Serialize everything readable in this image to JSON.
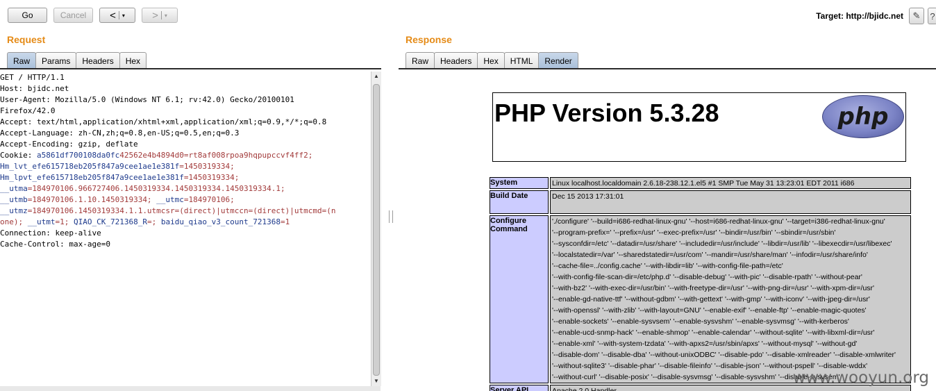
{
  "toolbar": {
    "go_label": "Go",
    "cancel_label": "Cancel",
    "back_label": "<",
    "forward_label": ">",
    "dropdown": "▾",
    "target_prefix": "Target: ",
    "target_url": "http://bjidc.net"
  },
  "request": {
    "title": "Request",
    "tabs": [
      "Raw",
      "Params",
      "Headers",
      "Hex"
    ],
    "active_tab": "Raw",
    "lines": [
      {
        "t": "GET / HTTP/1.1"
      },
      {
        "t": "Host: bjidc.net"
      },
      {
        "t": "User-Agent: Mozilla/5.0 (Windows NT 6.1; rv:42.0) Gecko/20100101"
      },
      {
        "t": "Firefox/42.0"
      },
      {
        "t": "Accept: text/html,application/xhtml+xml,application/xml;q=0.9,*/*;q=0.8"
      },
      {
        "t": "Accept-Language: zh-CN,zh;q=0.8,en-US;q=0.5,en;q=0.3"
      },
      {
        "t": "Accept-Encoding: gzip, deflate"
      },
      {
        "parts": [
          [
            "",
            "Cookie: "
          ],
          [
            "ck",
            "a5861df700108da0fc"
          ],
          [
            "cv",
            "42562e4b4894d0=rt8af008rpoa9hqpupccvf4ff2;"
          ]
        ]
      },
      {
        "parts": [
          [
            "ck",
            "Hm_lvt_efe615718eb205f847a9cee1ae1e381f"
          ],
          [
            "cv",
            "=1450319334;"
          ]
        ]
      },
      {
        "parts": [
          [
            "ck",
            "Hm_lpvt_efe615718eb205f847a9cee1ae1e381f"
          ],
          [
            "cv",
            "=1450319334;"
          ]
        ]
      },
      {
        "parts": [
          [
            "ck",
            "__utma"
          ],
          [
            "cv",
            "=184970106.966727406.1450319334.1450319334.1450319334.1;"
          ]
        ]
      },
      {
        "parts": [
          [
            "ck",
            "__utmb"
          ],
          [
            "cv",
            "=184970106.1.10.1450319334;"
          ],
          [
            "ck",
            " __utmc"
          ],
          [
            "cv",
            "=184970106;"
          ]
        ]
      },
      {
        "parts": [
          [
            "ck",
            "__utmz"
          ],
          [
            "cv",
            "=184970106.1450319334.1.1.utmcsr=(direct)|utmccn=(direct)|utmcmd=(n"
          ]
        ]
      },
      {
        "parts": [
          [
            "cv",
            "one);"
          ],
          [
            "ck",
            " __utmt"
          ],
          [
            "cv",
            "=1;"
          ],
          [
            "ck",
            " QIAO_CK_721368_R"
          ],
          [
            "cv",
            "=;"
          ],
          [
            "ck",
            " baidu_qiao_v3_count_721368"
          ],
          [
            "cv",
            "=1"
          ]
        ]
      },
      {
        "t": "Connection: keep-alive"
      },
      {
        "t": "Cache-Control: max-age=0"
      }
    ]
  },
  "response": {
    "title": "Response",
    "tabs": [
      "Raw",
      "Headers",
      "Hex",
      "HTML",
      "Render"
    ],
    "active_tab": "Render",
    "php_version": "PHP Version 5.3.28",
    "php_logo_text": "php",
    "rows": [
      {
        "key": "System",
        "lines": [
          "Linux localhost.localdomain 2.6.18-238.12.1.el5 #1 SMP Tue May 31 13:23:01 EDT 2011 i686"
        ]
      },
      {
        "key": "Build Date",
        "lines": [
          "Dec 15 2013 17:31:01"
        ]
      },
      {
        "key": "Configure Command",
        "lines": [
          "'./configure' '--build=i686-redhat-linux-gnu' '--host=i686-redhat-linux-gnu' '--target=i386-redhat-linux-gnu'",
          "'--program-prefix=' '--prefix=/usr' '--exec-prefix=/usr' '--bindir=/usr/bin' '--sbindir=/usr/sbin'",
          "'--sysconfdir=/etc' '--datadir=/usr/share' '--includedir=/usr/include' '--libdir=/usr/lib' '--libexecdir=/usr/libexec'",
          "'--localstatedir=/var' '--sharedstatedir=/usr/com' '--mandir=/usr/share/man' '--infodir=/usr/share/info'",
          "'--cache-file=../config.cache' '--with-libdir=lib' '--with-config-file-path=/etc'",
          "'--with-config-file-scan-dir=/etc/php.d' '--disable-debug' '--with-pic' '--disable-rpath' '--without-pear'",
          "'--with-bz2' '--with-exec-dir=/usr/bin' '--with-freetype-dir=/usr' '--with-png-dir=/usr' '--with-xpm-dir=/usr'",
          "'--enable-gd-native-ttf' '--without-gdbm' '--with-gettext' '--with-gmp' '--with-iconv' '--with-jpeg-dir=/usr'",
          "'--with-openssl' '--with-zlib' '--with-layout=GNU' '--enable-exif' '--enable-ftp' '--enable-magic-quotes'",
          "'--enable-sockets' '--enable-sysvsem' '--enable-sysvshm' '--enable-sysvmsg' '--with-kerberos'",
          "'--enable-ucd-snmp-hack' '--enable-shmop' '--enable-calendar' '--without-sqlite' '--with-libxml-dir=/usr'",
          "'--enable-xml' '--with-system-tzdata' '--with-apxs2=/usr/sbin/apxs' '--without-mysql' '--without-gd'",
          "'--disable-dom' '--disable-dba' '--without-unixODBC' '--disable-pdo' '--disable-xmlreader' '--disable-xmlwriter'",
          "'--without-sqlite3' '--disable-phar' '--disable-fileinfo' '--disable-json' '--without-pspell' '--disable-wddx'",
          "'--without-curl' '--disable-posix' '--disable-sysvmsg' '--disable-sysvshm' '--disable-sysvsem'"
        ]
      },
      {
        "key": "Server API",
        "lines": [
          "Apache 2.0 Handler"
        ]
      }
    ]
  },
  "watermark": "www.wooyun.org",
  "colors": {
    "accent_title": "#e58b17",
    "php_key_bg": "#ccccff",
    "php_value_bg": "#cccccc"
  }
}
